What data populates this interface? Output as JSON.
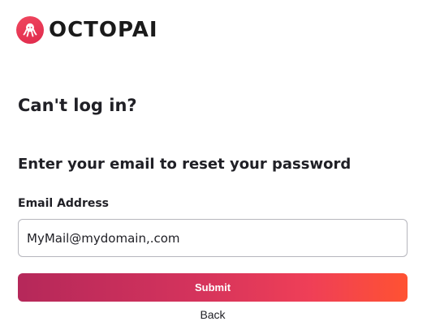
{
  "brand": {
    "name": "OCTOPAI",
    "logo_icon": "octopus-icon",
    "accent_color": "#e8364f"
  },
  "form": {
    "title": "Can't log in?",
    "subtitle": "Enter your email to reset your password",
    "email_label": "Email Address",
    "email_value": "MyMail@mydomain,.com",
    "submit_label": "Submit",
    "back_label": "Back",
    "button_gradient": [
      "#b5285a",
      "#ff5232"
    ]
  }
}
